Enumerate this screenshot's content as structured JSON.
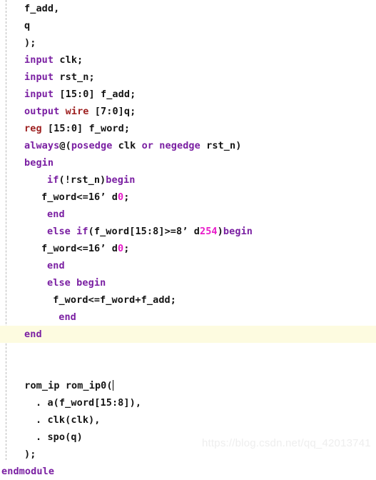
{
  "editor": {
    "language": "verilog",
    "highlight_line_index": 19,
    "caret_line_index": 19,
    "colors": {
      "background": "#ffffff",
      "keyword": "#7a1fa2",
      "type": "#9d1f1f",
      "number": "#e81ac9",
      "identifier": "#141414",
      "current_line_highlight": "#fdfbe0",
      "indent_guide": "#b9b9b9",
      "watermark": "#eeeeee"
    },
    "lines": [
      {
        "indent": 4,
        "tokens": [
          {
            "t": "f_add,",
            "c": "id"
          }
        ]
      },
      {
        "indent": 4,
        "tokens": [
          {
            "t": "q",
            "c": "id"
          }
        ]
      },
      {
        "indent": 4,
        "tokens": [
          {
            "t": ");",
            "c": "pl"
          }
        ]
      },
      {
        "indent": 4,
        "tokens": [
          {
            "t": "input",
            "c": "kw"
          },
          {
            "t": " clk;",
            "c": "id"
          }
        ]
      },
      {
        "indent": 4,
        "tokens": [
          {
            "t": "input",
            "c": "kw"
          },
          {
            "t": " rst_n;",
            "c": "id"
          }
        ]
      },
      {
        "indent": 4,
        "tokens": [
          {
            "t": "input",
            "c": "kw"
          },
          {
            "t": " [15:0] f_add;",
            "c": "id"
          }
        ]
      },
      {
        "indent": 4,
        "tokens": [
          {
            "t": "output",
            "c": "kw"
          },
          {
            "t": " ",
            "c": "pl"
          },
          {
            "t": "wire",
            "c": "typ"
          },
          {
            "t": " [7:0]q;",
            "c": "id"
          }
        ]
      },
      {
        "indent": 4,
        "tokens": [
          {
            "t": "reg",
            "c": "typ"
          },
          {
            "t": " [15:0] f_word;",
            "c": "id"
          }
        ]
      },
      {
        "indent": 4,
        "tokens": [
          {
            "t": "always",
            "c": "kw"
          },
          {
            "t": "@(",
            "c": "pl"
          },
          {
            "t": "posedge",
            "c": "kw"
          },
          {
            "t": " clk ",
            "c": "id"
          },
          {
            "t": "or",
            "c": "kw"
          },
          {
            "t": " ",
            "c": "id"
          },
          {
            "t": "negedge",
            "c": "kw"
          },
          {
            "t": " rst_n)",
            "c": "id"
          }
        ]
      },
      {
        "indent": 4,
        "tokens": [
          {
            "t": "begin",
            "c": "kw"
          }
        ]
      },
      {
        "indent": 8,
        "tokens": [
          {
            "t": "if",
            "c": "kw"
          },
          {
            "t": "(!rst_n)",
            "c": "id"
          },
          {
            "t": "begin",
            "c": "kw"
          }
        ]
      },
      {
        "indent": 7,
        "tokens": [
          {
            "t": "f_word<=16",
            "c": "id"
          },
          {
            "t": "’ d",
            "c": "id"
          },
          {
            "t": "0",
            "c": "num"
          },
          {
            "t": ";",
            "c": "id"
          }
        ]
      },
      {
        "indent": 8,
        "tokens": [
          {
            "t": "end",
            "c": "kw"
          }
        ]
      },
      {
        "indent": 8,
        "tokens": [
          {
            "t": "else",
            "c": "kw"
          },
          {
            "t": " ",
            "c": "id"
          },
          {
            "t": "if",
            "c": "kw"
          },
          {
            "t": "(f_word[15:8]>=8",
            "c": "id"
          },
          {
            "t": "’ d",
            "c": "id"
          },
          {
            "t": "254",
            "c": "num"
          },
          {
            "t": ")",
            "c": "id"
          },
          {
            "t": "begin",
            "c": "kw"
          }
        ]
      },
      {
        "indent": 7,
        "tokens": [
          {
            "t": "f_word<=16",
            "c": "id"
          },
          {
            "t": "’ d",
            "c": "id"
          },
          {
            "t": "0",
            "c": "num"
          },
          {
            "t": ";",
            "c": "id"
          }
        ]
      },
      {
        "indent": 8,
        "tokens": [
          {
            "t": "end",
            "c": "kw"
          }
        ]
      },
      {
        "indent": 8,
        "tokens": [
          {
            "t": "else",
            "c": "kw"
          },
          {
            "t": " ",
            "c": "id"
          },
          {
            "t": "begin",
            "c": "kw"
          }
        ]
      },
      {
        "indent": 8,
        "tokens": [
          {
            "t": " f_word<=f_word+f_add;",
            "c": "id"
          }
        ]
      },
      {
        "indent": 9,
        "tokens": [
          {
            "t": " end",
            "c": "kw"
          }
        ]
      },
      {
        "indent": 4,
        "tokens": [
          {
            "t": "end",
            "c": "kw"
          }
        ]
      },
      {
        "indent": 0,
        "tokens": []
      },
      {
        "indent": 0,
        "tokens": []
      },
      {
        "indent": 3,
        "tokens": [
          {
            "t": " rom_ip rom_ip0(",
            "c": "id"
          }
        ],
        "caret": true
      },
      {
        "indent": 6,
        "tokens": [
          {
            "t": ". a(f_word[15:8]),",
            "c": "id"
          }
        ]
      },
      {
        "indent": 6,
        "tokens": [
          {
            "t": ". clk(clk),",
            "c": "id"
          }
        ]
      },
      {
        "indent": 6,
        "tokens": [
          {
            "t": ". spo(q)",
            "c": "id"
          }
        ]
      },
      {
        "indent": 4,
        "tokens": [
          {
            "t": ");",
            "c": "pl"
          }
        ]
      },
      {
        "indent": 0,
        "tokens": [
          {
            "t": "endmodule",
            "c": "kw"
          }
        ]
      }
    ]
  },
  "watermark": {
    "text": "https://blog.csdn.net/qq_42013741"
  }
}
